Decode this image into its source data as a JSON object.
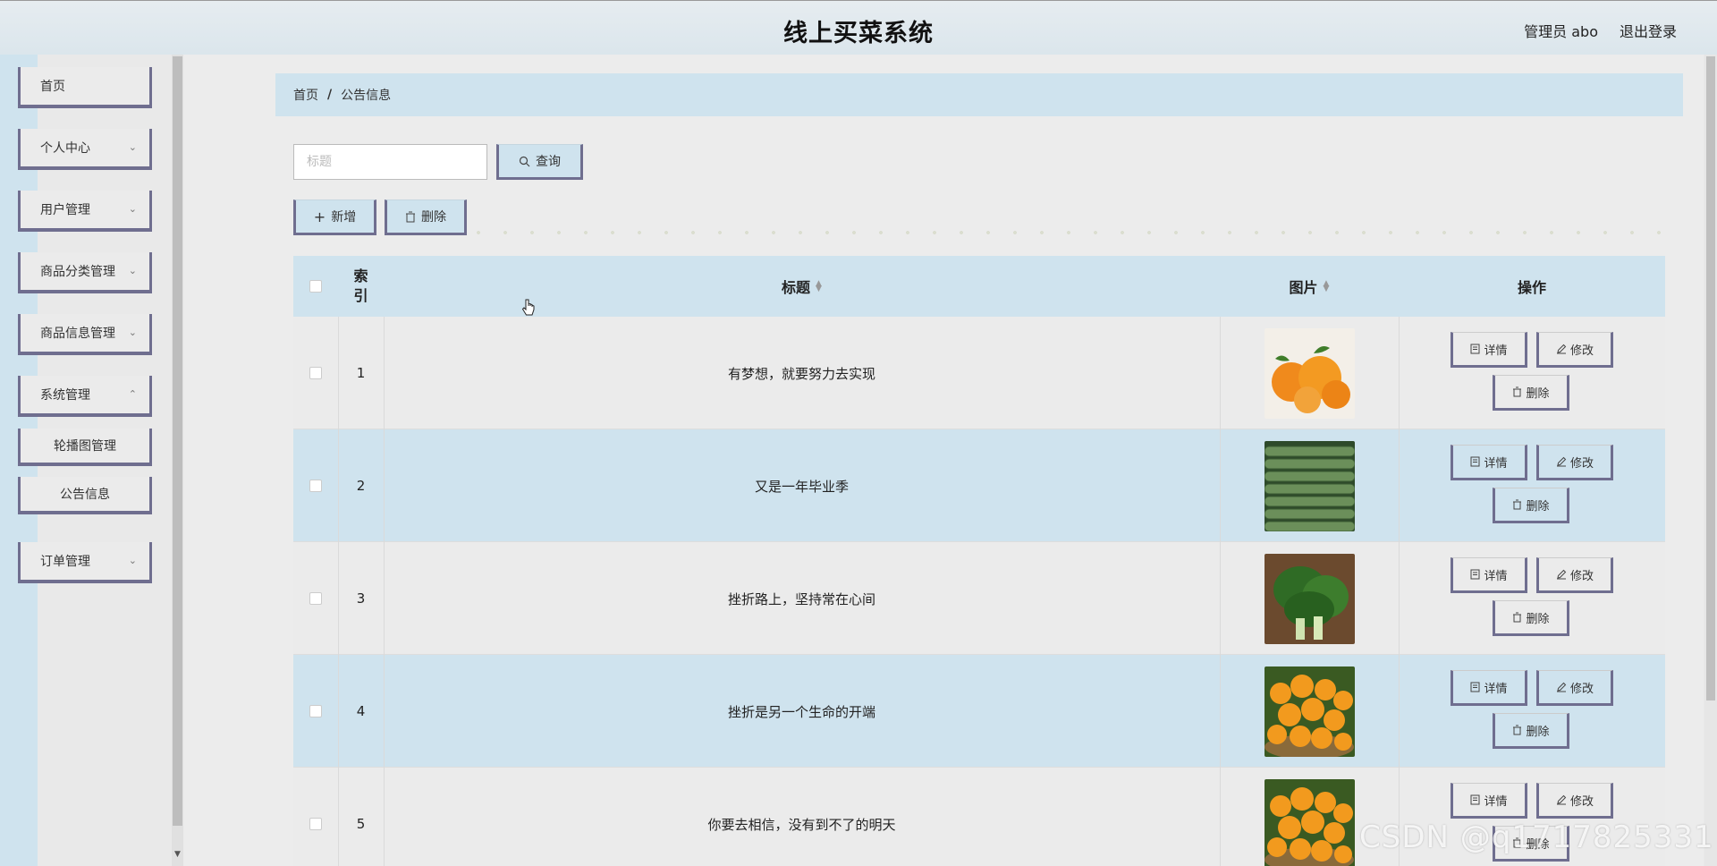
{
  "header": {
    "title": "线上买菜系统",
    "user_label": "管理员 abo",
    "logout_label": "退出登录"
  },
  "sidebar": {
    "items": [
      {
        "label": "首页",
        "has_children": false
      },
      {
        "label": "个人中心",
        "has_children": true
      },
      {
        "label": "用户管理",
        "has_children": true
      },
      {
        "label": "商品分类管理",
        "has_children": true
      },
      {
        "label": "商品信息管理",
        "has_children": true
      },
      {
        "label": "系统管理",
        "has_children": true
      }
    ],
    "submenu": [
      {
        "label": "轮播图管理"
      },
      {
        "label": "公告信息"
      }
    ],
    "last_item": {
      "label": "订单管理",
      "has_children": true
    }
  },
  "breadcrumb": {
    "home": "首页",
    "separator": "/",
    "current": "公告信息"
  },
  "search": {
    "placeholder": "标题",
    "query_label": "查询"
  },
  "toolbar": {
    "add_label": "新增",
    "delete_label": "删除"
  },
  "table": {
    "columns": {
      "index": "索引",
      "title": "标题",
      "image": "图片",
      "actions": "操作"
    },
    "rows": [
      {
        "index": "1",
        "title": "有梦想，就要努力去实现",
        "image": "oranges-icon"
      },
      {
        "index": "2",
        "title": "又是一年毕业季",
        "image": "cucumbers-icon"
      },
      {
        "index": "3",
        "title": "挫折路上，坚持常在心间",
        "image": "greens-icon"
      },
      {
        "index": "4",
        "title": "挫折是另一个生命的开端",
        "image": "orange-basket-icon"
      },
      {
        "index": "5",
        "title": "你要去相信，没有到不了的明天",
        "image": "orange-basket-icon"
      }
    ],
    "actions": {
      "detail": "详情",
      "edit": "修改",
      "delete": "删除"
    }
  },
  "watermark": "CSDN @q1717825331",
  "colors": {
    "accent": "#cfe3ee",
    "border": "#6f6e8f",
    "background": "#e9e9e9"
  }
}
